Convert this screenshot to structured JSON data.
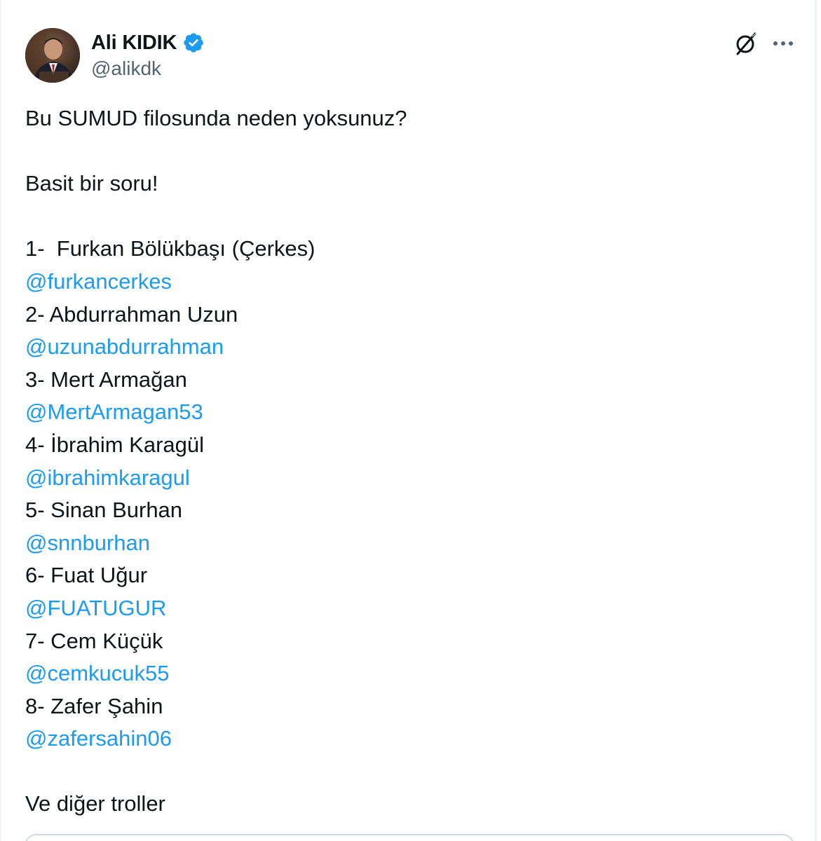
{
  "author": {
    "display_name": "Ali KIDIK",
    "handle": "@alikdk",
    "verified": true,
    "verified_color": "#1d9bf0"
  },
  "actions": {
    "grok_icon": "grok-icon",
    "more_icon": "more-dots-icon"
  },
  "tweet": {
    "line_1": "Bu SUMUD filosunda neden yoksunuz?",
    "line_2": "Basit bir soru!",
    "list": [
      {
        "name": "1-  Furkan Bölükbaşı (Çerkes)",
        "mention": "@furkancerkes"
      },
      {
        "name": "2- Abdurrahman Uzun",
        "mention": "@uzunabdurrahman"
      },
      {
        "name": "3- Mert Armağan",
        "mention": "@MertArmagan53"
      },
      {
        "name": "4- İbrahim Karagül",
        "mention": "@ibrahimkaragul"
      },
      {
        "name": "5- Sinan Burhan",
        "mention": "@snnburhan"
      },
      {
        "name": "6- Fuat Uğur",
        "mention": "@FUATUGUR"
      },
      {
        "name": "7- Cem Küçük",
        "mention": "@cemkucuk55"
      },
      {
        "name": "8- Zafer Şahin",
        "mention": "@zafersahin06"
      }
    ],
    "closing": "Ve diğer troller"
  },
  "colors": {
    "link": "#1d9bf0",
    "text": "#0f1419",
    "secondary": "#536471",
    "border": "#cfd9de"
  }
}
